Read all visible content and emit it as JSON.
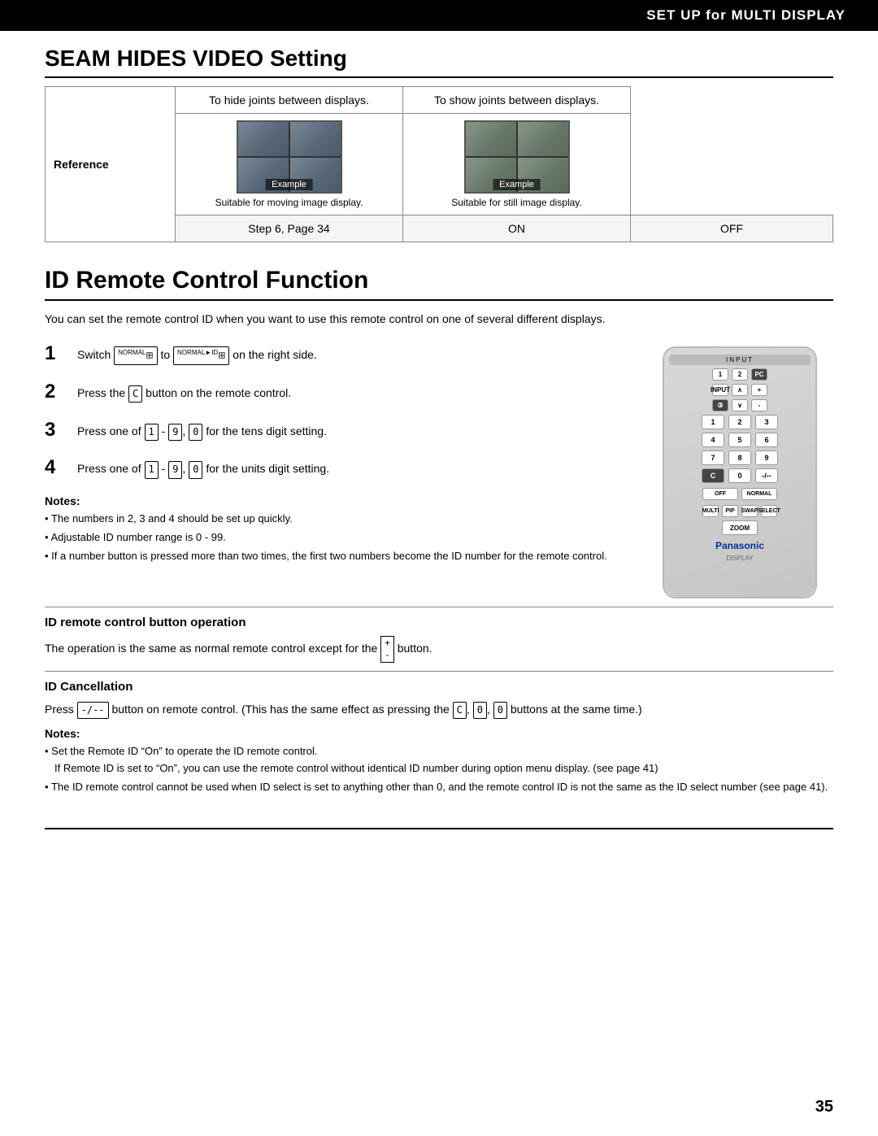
{
  "header": {
    "title": "SET UP for MULTI DISPLAY"
  },
  "seam_section": {
    "title": "SEAM HIDES VIDEO Setting",
    "table": {
      "col1_header": "Reference",
      "col2_header": "To hide joints between displays.",
      "col2_sublabel": "Example",
      "col2_caption": "Suitable for moving image display.",
      "col2_setting": "ON",
      "col3_header": "To show joints between displays.",
      "col3_sublabel": "Example",
      "col3_caption": "Suitable for still image display.",
      "col3_setting": "OFF",
      "ref_step": "Step 6, Page 34"
    }
  },
  "id_section": {
    "title": "ID Remote Control Function",
    "intro": "You can set the remote control ID when you want to use this remote control on one of several different displays.",
    "steps": [
      {
        "num": "1",
        "text": "Switch NORMAL to NORMAL on the right side."
      },
      {
        "num": "2",
        "text": "Press the [C] button on the remote control."
      },
      {
        "num": "3",
        "text": "Press one of [1] - [9], [0] for the tens digit setting."
      },
      {
        "num": "4",
        "text": "Press one of [1] - [9], [0] for the units digit setting."
      }
    ],
    "notes1_title": "Notes:",
    "notes1": [
      "The numbers in 2, 3 and 4 should be set up quickly.",
      "Adjustable ID number range is 0 - 99.",
      "If a number button is pressed more than two times, the first two numbers become the ID number for the remote control."
    ],
    "subsection1": {
      "title": "ID remote control button operation",
      "body": "The operation is the same as normal remote control except for the [+/-] button."
    },
    "subsection2": {
      "title": "ID Cancellation",
      "body": "Press [-/--] button on remote control. (This has the same effect as pressing the [C], [0], [0] buttons at the same time.)"
    },
    "notes2_title": "Notes:",
    "notes2": [
      "Set the Remote ID \"On\" to operate the ID remote control.\nIf Remote ID is set to \"On\", you can use the remote control without identical ID number during option menu display.\n(see page 41)",
      "The ID remote control cannot be used when ID select is set to anything other than 0, and the remote control ID is not the same as the ID select number (see page 41)."
    ]
  },
  "page_number": "35"
}
